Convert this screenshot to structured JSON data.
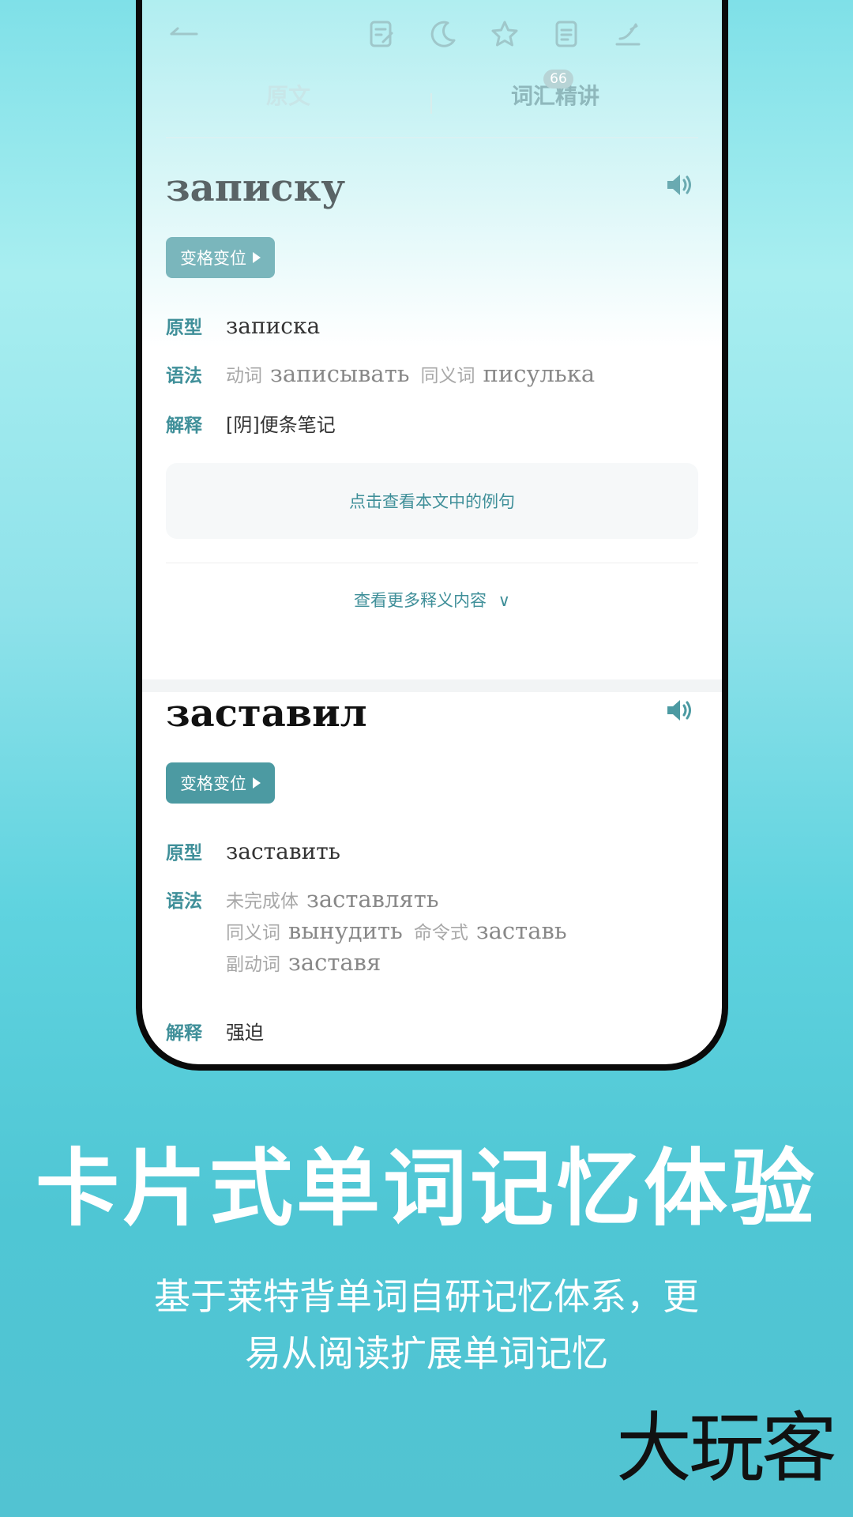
{
  "toolbar": {
    "icons": [
      "back-arrow-icon",
      "note-edit-icon",
      "moon-icon",
      "star-icon",
      "document-icon",
      "signature-icon"
    ]
  },
  "tabs": {
    "items": [
      {
        "label": "原文",
        "active": false
      },
      {
        "label": "词汇精讲",
        "active": true
      }
    ],
    "badge": "66"
  },
  "cards": [
    {
      "word": "записку",
      "inflect_label": "变格变位",
      "base_label": "原型",
      "base_value": "записка",
      "grammar_label": "语法",
      "grammar": [
        [
          {
            "tag": "动词",
            "word": "записывать"
          },
          {
            "tag": "同义词",
            "word": "писулька"
          }
        ]
      ],
      "meaning_label": "解释",
      "meaning": "[阴]便条笔记",
      "example_button": "点击查看本文中的例句",
      "more_label": "查看更多释义内容"
    },
    {
      "word": "заставил",
      "inflect_label": "变格变位",
      "base_label": "原型",
      "base_value": "заставить",
      "grammar_label": "语法",
      "grammar": [
        [
          {
            "tag": "未完成体",
            "word": "заставлять"
          }
        ],
        [
          {
            "tag": "同义词",
            "word": "вынудить"
          },
          {
            "tag": "命令式",
            "word": "заставь"
          }
        ],
        [
          {
            "tag": "副动词",
            "word": "заставя"
          }
        ]
      ],
      "meaning_label": "解释",
      "meaning": "强迫"
    }
  ],
  "promo": {
    "headline": "卡片式单词记忆体验",
    "subline_1": "基于莱特背单词自研记忆体系，更",
    "subline_2": "易从阅读扩展单词记忆",
    "logo": "大玩客"
  },
  "colors": {
    "accent": "#3f8f99",
    "button_dim": "#7ab6bc",
    "button_active": "#4c9aa2",
    "background_top": "#7fe0e8",
    "background_bottom": "#52c3d2"
  }
}
